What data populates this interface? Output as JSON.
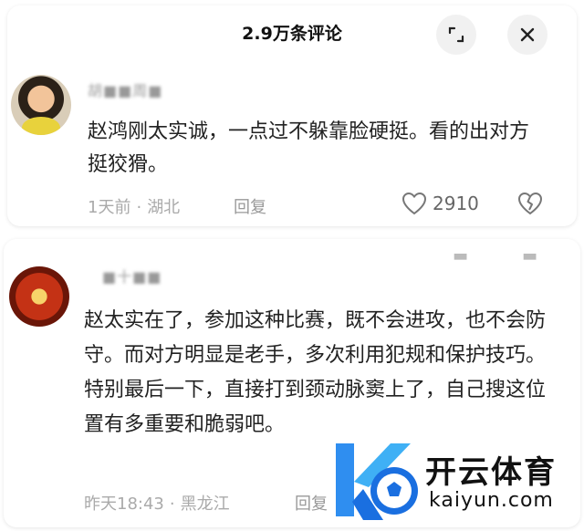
{
  "header": {
    "title": "2.9万条评论",
    "expand_icon": "expand-icon",
    "close_icon": "close-icon"
  },
  "comments": [
    {
      "username": "胡■■周■",
      "text": "赵鸿刚太实诚，一点过不躲靠脸硬挺。看的出对方挺狡猾。",
      "time": "1天前",
      "location": "湖北",
      "reply_label": "回复",
      "likes": "2910"
    },
    {
      "username": "■十■■",
      "text": "赵太实在了，参加这种比赛，既不会进攻，也不会防守。而对方明显是老手，多次利用犯规和保护技巧。特别最后一下，直接打到颈动脉窦上了，自己搜这位置有多重要和脆弱吧。",
      "time": "昨天18:43",
      "location": "黑龙江",
      "reply_label": "回复"
    }
  ],
  "watermark": {
    "name": "开云体育",
    "site": "kaiyun.com"
  },
  "colors": {
    "accent_blue": "#1a6fe0",
    "muted": "#aaaaaa"
  }
}
